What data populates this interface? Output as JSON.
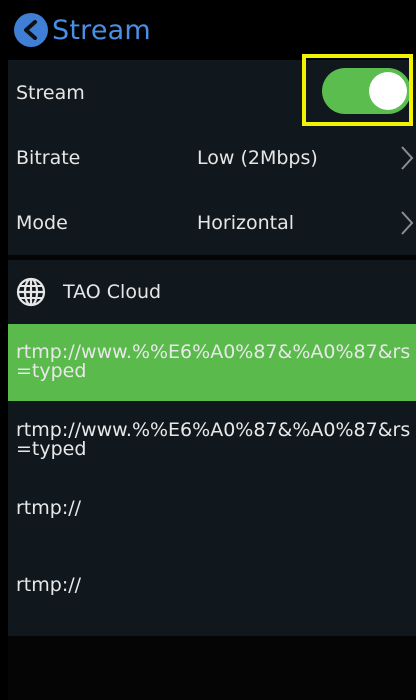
{
  "header": {
    "title": "Stream"
  },
  "settings": {
    "stream": {
      "label": "Stream",
      "enabled": true
    },
    "bitrate": {
      "label": "Bitrate",
      "value": "Low (2Mbps)"
    },
    "mode": {
      "label": "Mode",
      "value": "Horizontal"
    }
  },
  "cloud": {
    "name": "TAO Cloud",
    "items": [
      {
        "text": "rtmp://www.%%E6%A0%87&%A0%87&rs=typed",
        "selected": true
      },
      {
        "text": "rtmp://www.%%E6%A0%87&%A0%87&rs=typed",
        "selected": false
      },
      {
        "text": "rtmp://",
        "selected": false
      },
      {
        "text": "rtmp://",
        "selected": false
      }
    ]
  },
  "colors": {
    "accent": "#4a8fe6",
    "toggle_on": "#5bbd4e",
    "selected_row": "#5aba4c",
    "highlight_box": "#f2f300"
  }
}
